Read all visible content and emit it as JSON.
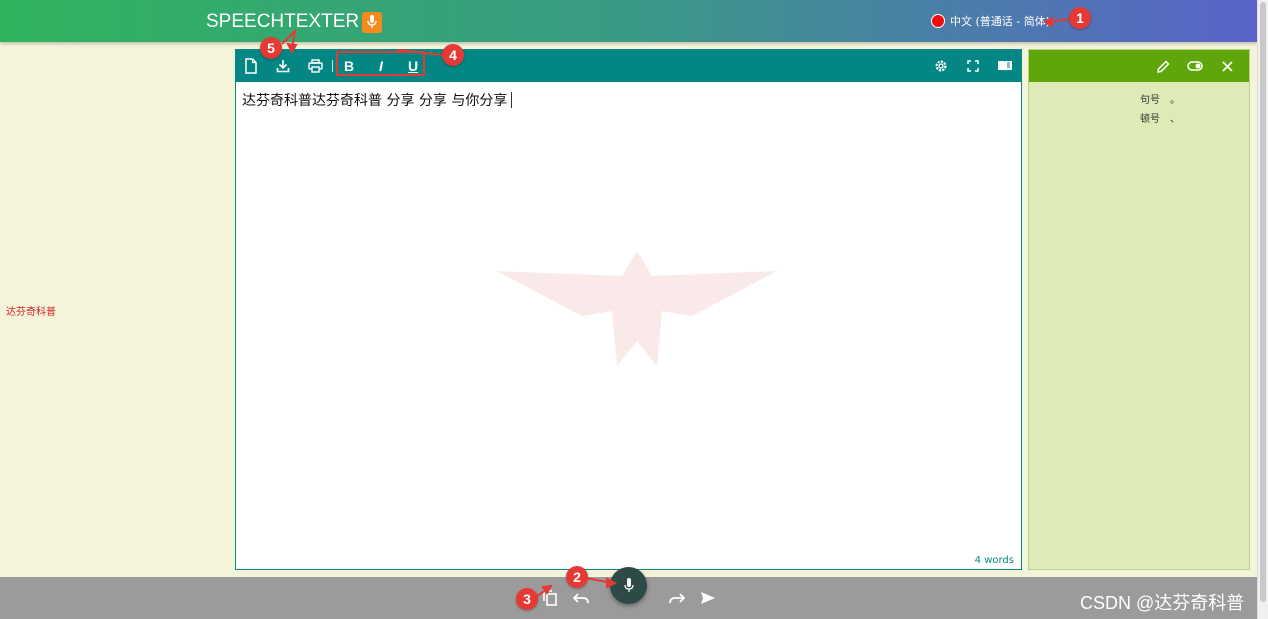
{
  "header": {
    "logo_text": "SPEECHTEXTER",
    "language_label": "中文 (普通话 - 简体)"
  },
  "toolbar": {
    "icons": [
      "new-document-icon",
      "download-icon",
      "print-icon",
      "bold-icon",
      "italic-icon",
      "underline-icon",
      "settings-icon",
      "fullscreen-icon",
      "reading-mode-icon"
    ],
    "bold_label": "B",
    "italic_label": "I",
    "underline_label": "U"
  },
  "editor": {
    "text": "达芬奇科普达芬奇科普 分享 分享 与你分享",
    "word_count": "4 words"
  },
  "side_panel": {
    "icons": [
      "edit-icon",
      "toggle-icon",
      "close-icon"
    ],
    "punctuation": [
      {
        "name": "句号",
        "symbol": "。"
      },
      {
        "name": "顿号",
        "symbol": "、"
      }
    ]
  },
  "side_label": "达芬奇科普",
  "bottom_bar": {
    "icons": [
      "copy-icon",
      "undo-icon",
      "microphone-icon",
      "redo-icon",
      "send-icon"
    ]
  },
  "watermark_text": "CSDN @达芬奇科普",
  "annotations": [
    "1",
    "2",
    "3",
    "4",
    "5"
  ],
  "colors": {
    "toolbar": "#048784",
    "panel_bar": "#5ea60a",
    "panel_bg": "#dfebb7",
    "mic_button": "#2d4a47",
    "logo_mic": "#f58b1f",
    "annotation": "#e53935",
    "recording_dot": "#f20d0d"
  }
}
